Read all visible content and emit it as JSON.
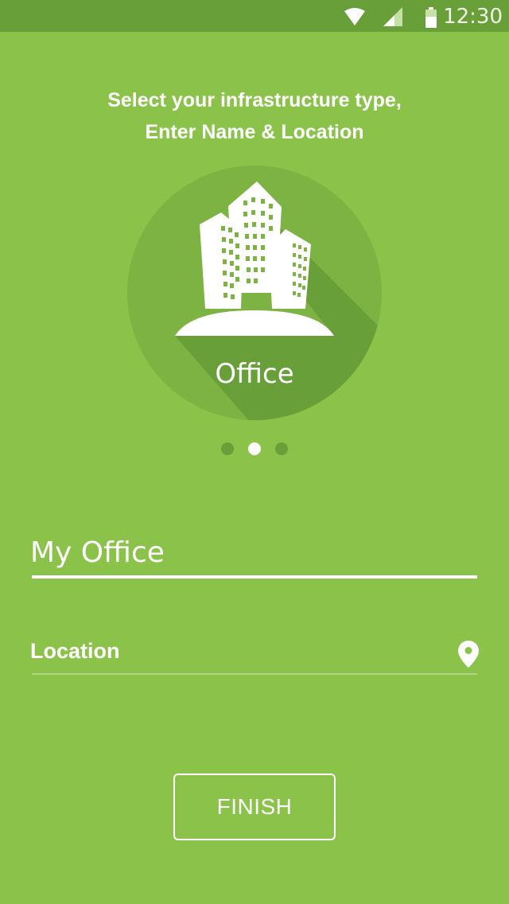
{
  "status_bar": {
    "time": "12:30",
    "icons": [
      "wifi-icon",
      "signal-icon",
      "battery-icon"
    ]
  },
  "instructions": {
    "line1": "Select your infrastructure type,",
    "line2": "Enter Name & Location"
  },
  "carousel": {
    "selected_type": "Office",
    "icon": "office-buildings-icon",
    "page_count": 3,
    "active_page": 2
  },
  "form": {
    "name_value": "My Office",
    "location_placeholder": "Location",
    "location_icon": "map-pin-icon"
  },
  "actions": {
    "finish_label": "FINISH"
  },
  "colors": {
    "background": "#8bc34a",
    "status_bar": "#689f38",
    "circle": "#7cb342",
    "shadow": "#689f38",
    "foreground": "#ffffff"
  }
}
